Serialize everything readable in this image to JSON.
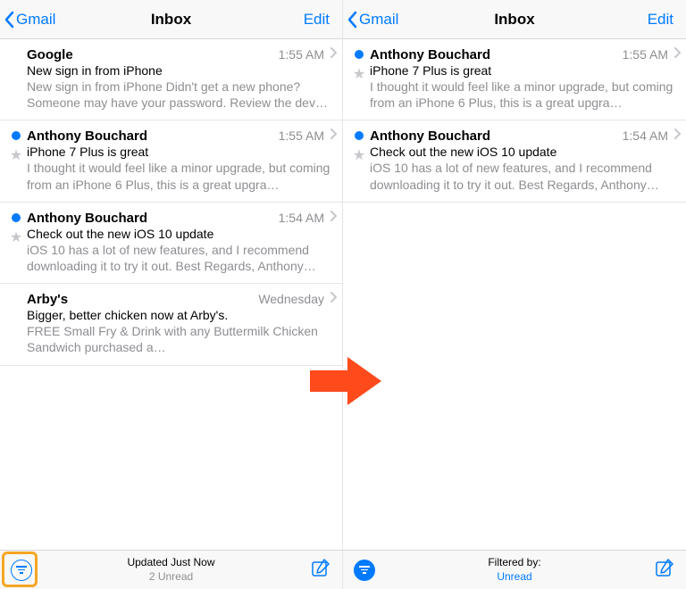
{
  "left": {
    "nav": {
      "back": "Gmail",
      "title": "Inbox",
      "edit": "Edit"
    },
    "messages": [
      {
        "unread": false,
        "flaggable": false,
        "sender": "Google",
        "time": "1:55 AM",
        "subject": "New sign in from iPhone",
        "preview": "New sign in from iPhone Didn't get a new phone? Someone may have your password. Review the dev…"
      },
      {
        "unread": true,
        "flaggable": true,
        "sender": "Anthony Bouchard",
        "time": "1:55 AM",
        "subject": "iPhone 7 Plus is great",
        "preview": "I thought it would feel like a minor upgrade, but coming from an iPhone 6 Plus, this is a great upgra…"
      },
      {
        "unread": true,
        "flaggable": true,
        "sender": "Anthony Bouchard",
        "time": "1:54 AM",
        "subject": "Check out the new iOS 10 update",
        "preview": "iOS 10 has a lot of new features, and I recommend downloading it to try it out. Best Regards, Anthony…"
      },
      {
        "unread": false,
        "flaggable": false,
        "sender": "Arby's",
        "time": "Wednesday",
        "subject": "Bigger, better chicken now at Arby's.",
        "preview": "FREE Small Fry & Drink\nwith any Buttermilk Chicken Sandwich purchased a…"
      }
    ],
    "toolbar": {
      "top": "Updated Just Now",
      "bottom": "2 Unread"
    }
  },
  "right": {
    "nav": {
      "back": "Gmail",
      "title": "Inbox",
      "edit": "Edit"
    },
    "messages": [
      {
        "unread": true,
        "flaggable": true,
        "sender": "Anthony Bouchard",
        "time": "1:55 AM",
        "subject": "iPhone 7 Plus is great",
        "preview": "I thought it would feel like a minor upgrade, but coming from an iPhone 6 Plus, this is a great upgra…"
      },
      {
        "unread": true,
        "flaggable": true,
        "sender": "Anthony Bouchard",
        "time": "1:54 AM",
        "subject": "Check out the new iOS 10 update",
        "preview": "iOS 10 has a lot of new features, and I recommend downloading it to try it out. Best Regards, Anthony…"
      }
    ],
    "toolbar": {
      "top": "Filtered by:",
      "bottom": "Unread"
    }
  }
}
